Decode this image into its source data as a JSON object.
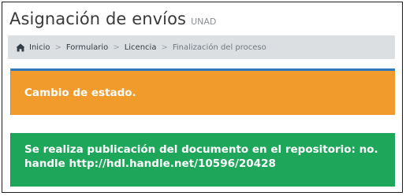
{
  "header": {
    "title": "Asignación de envíos",
    "subtitle": "UNAD"
  },
  "breadcrumb": {
    "home_icon": "home-icon",
    "separator": ">",
    "items": [
      "Inicio",
      "Formulario",
      "Licencia",
      "Finalización del proceso"
    ]
  },
  "alerts": {
    "warning": {
      "text": "Cambio de estado.",
      "color": "#f19b2c"
    },
    "success": {
      "text": "Se realiza publicación del documento en el repositorio: no. handle http://hdl.handle.net/10596/20428",
      "color": "#1ea65a"
    }
  }
}
